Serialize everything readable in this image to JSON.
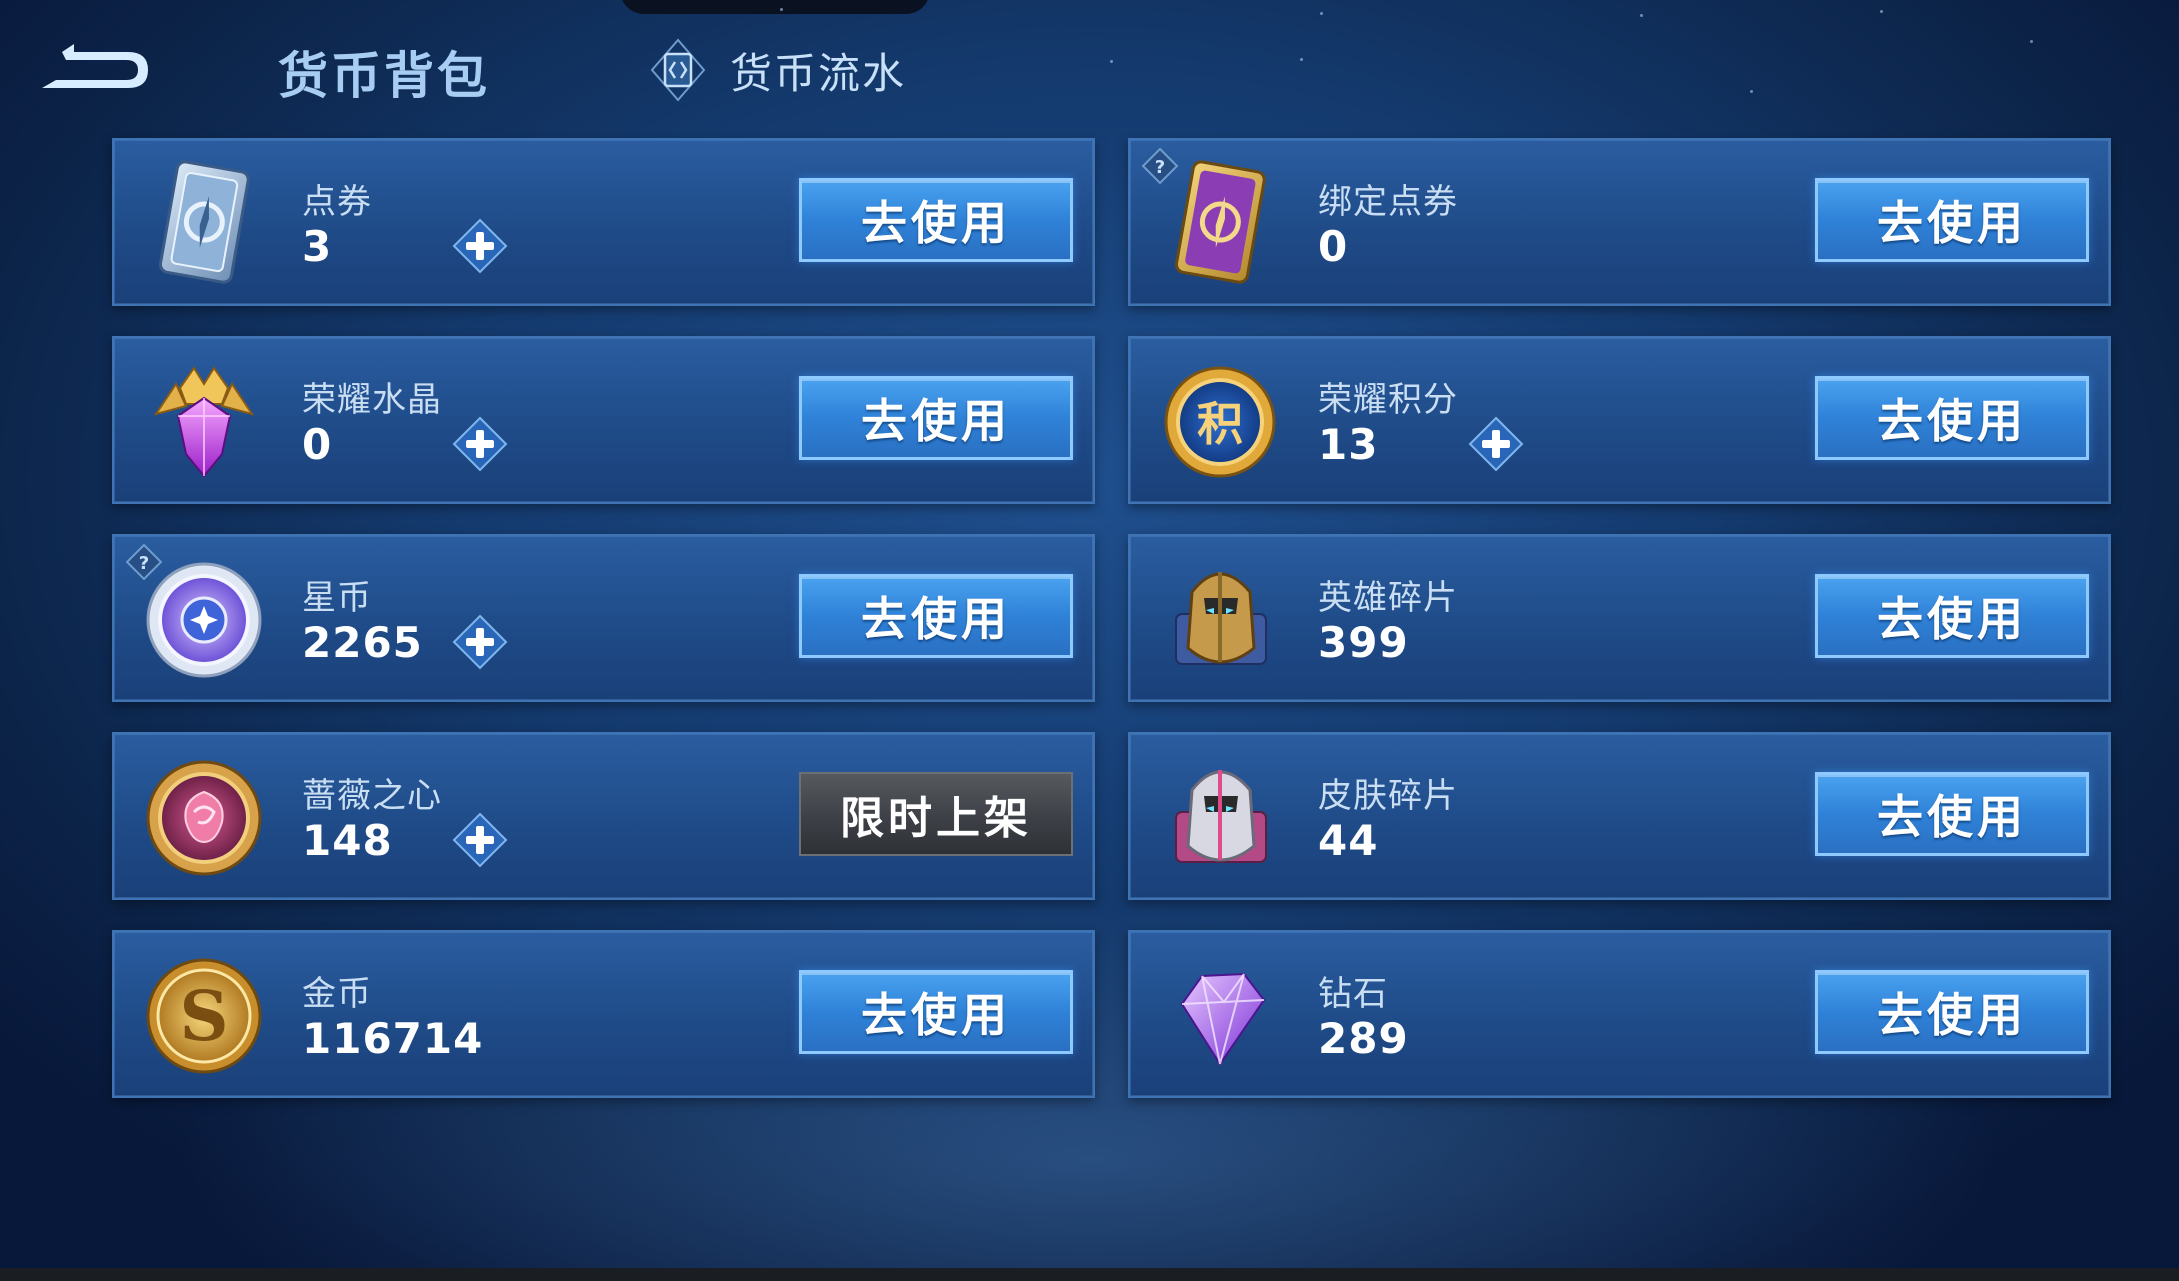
{
  "header": {
    "title": "货币背包",
    "tab_flow_label": "货币流水",
    "back_icon": "back-arrow-icon",
    "flow_icon": "ledger-icon"
  },
  "use_label": "去使用",
  "limited_label": "限时上架",
  "currencies": [
    {
      "name": "点券",
      "value": "3",
      "icon": "voucher-card-icon",
      "has_plus": true,
      "has_help": false,
      "action": "use"
    },
    {
      "name": "绑定点券",
      "value": "0",
      "icon": "bound-voucher-card-icon",
      "has_plus": false,
      "has_help": true,
      "action": "use"
    },
    {
      "name": "荣耀水晶",
      "value": "0",
      "icon": "glory-crystal-icon",
      "has_plus": true,
      "has_help": false,
      "action": "use"
    },
    {
      "name": "荣耀积分",
      "value": "13",
      "icon": "glory-points-icon",
      "has_plus": true,
      "has_help": false,
      "action": "use"
    },
    {
      "name": "星币",
      "value": "2265",
      "icon": "star-coin-icon",
      "has_plus": true,
      "has_help": true,
      "action": "use"
    },
    {
      "name": "英雄碎片",
      "value": "399",
      "icon": "hero-fragment-icon",
      "has_plus": false,
      "has_help": false,
      "action": "use"
    },
    {
      "name": "蔷薇之心",
      "value": "148",
      "icon": "rose-heart-icon",
      "has_plus": true,
      "has_help": false,
      "action": "limited"
    },
    {
      "name": "皮肤碎片",
      "value": "44",
      "icon": "skin-fragment-icon",
      "has_plus": false,
      "has_help": false,
      "action": "use"
    },
    {
      "name": "金币",
      "value": "116714",
      "icon": "gold-coin-icon",
      "has_plus": false,
      "has_help": false,
      "action": "use"
    },
    {
      "name": "钻石",
      "value": "289",
      "icon": "diamond-icon",
      "has_plus": false,
      "has_help": false,
      "action": "use"
    }
  ],
  "colors": {
    "background": "#143a6e",
    "card": "#1f4b88",
    "button": "#2f82d8",
    "limited_button": "#3d4046",
    "title_text": "#a8cdf2"
  }
}
